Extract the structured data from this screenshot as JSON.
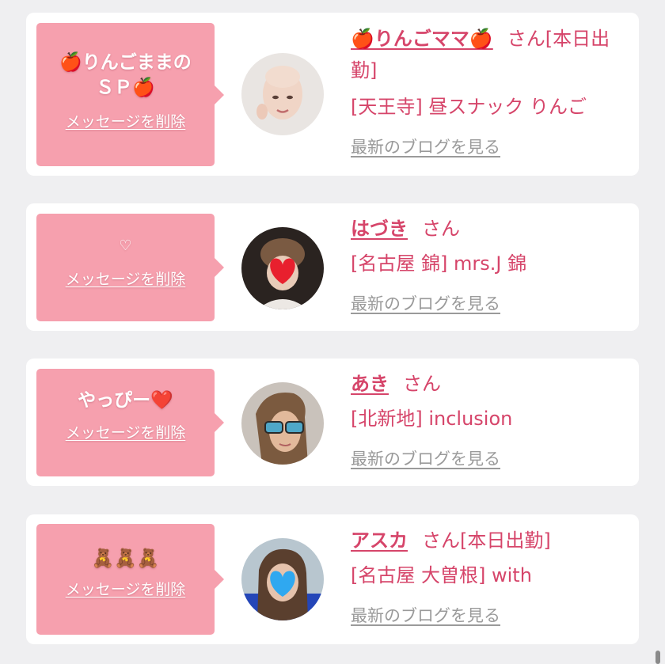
{
  "common": {
    "delete_label": "メッセージを削除",
    "blog_label": "最新のブログを見る",
    "san": "さん"
  },
  "cards": [
    {
      "message": "🍎りんごままのＳＰ🍎",
      "name": "🍎りんごママ🍎",
      "status": "[本日出勤]",
      "shop": "[天王寺] 昼スナック りんご",
      "avatar_icon": "bald-woman-avatar-icon"
    },
    {
      "message": "♡",
      "name": "はづき",
      "status": "",
      "shop": "[名古屋 錦] mrs.J 錦",
      "avatar_icon": "heart-covered-face-avatar-icon"
    },
    {
      "message": "やっぴー❤️",
      "name": "あき",
      "status": "",
      "shop": "[北新地] inclusion",
      "avatar_icon": "sunglasses-woman-avatar-icon"
    },
    {
      "message": "🧸🧸🧸",
      "name": "アスカ",
      "status": "[本日出勤]",
      "shop": "[名古屋 大曽根] with",
      "avatar_icon": "blue-heart-covered-face-avatar-icon"
    }
  ],
  "colors": {
    "bubble": "#f6a0ae",
    "accent": "#d6456a",
    "link_gray": "#9a9a9a",
    "background": "#efeff1"
  }
}
